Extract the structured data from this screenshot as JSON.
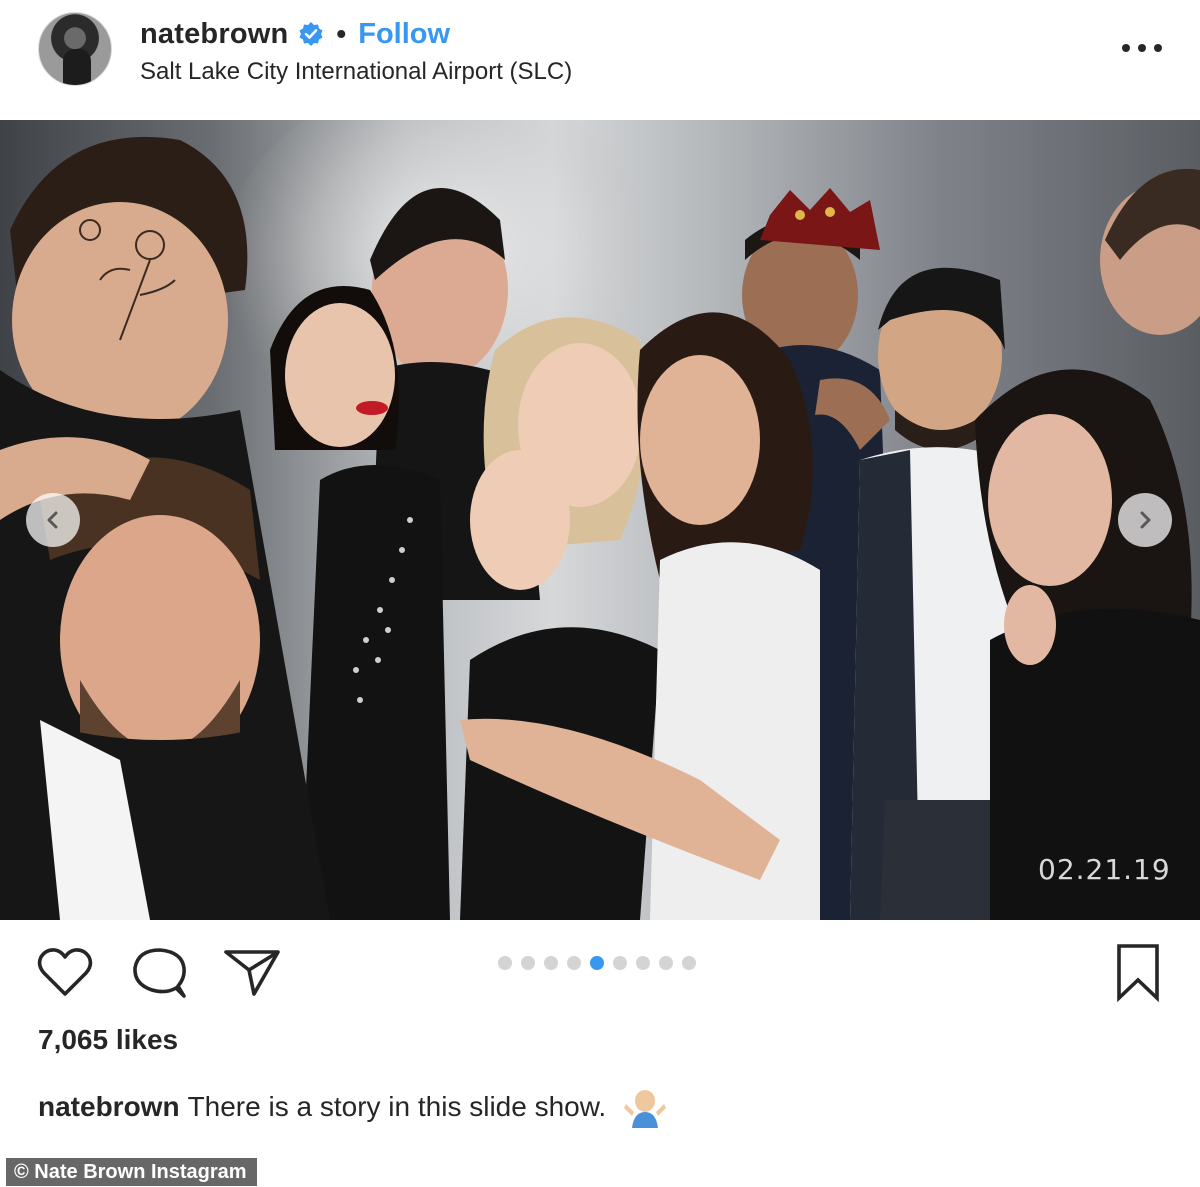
{
  "post": {
    "username": "natebrown",
    "follow_label": "Follow",
    "separator": "•",
    "location": "Salt Lake City International Airport (SLC)"
  },
  "photo": {
    "date_stamp": "02.21.19",
    "carousel_total": 9,
    "carousel_active_index": 4
  },
  "engagement": {
    "likes_label": "7,065 likes"
  },
  "caption": {
    "username": "natebrown",
    "text": "There is a story in this slide show."
  },
  "credit": "© Nate Brown Instagram",
  "icons": {
    "verified": "verified-badge-icon",
    "more": "more-options-icon",
    "like": "heart-icon",
    "comment": "comment-icon",
    "share": "paper-plane-icon",
    "save": "bookmark-icon",
    "prev": "chevron-left-icon",
    "next": "chevron-right-icon",
    "emoji": "person-shrugging-emoji"
  },
  "colors": {
    "link_blue": "#3897f0",
    "text": "#262626",
    "dot_inactive": "#d4d4d4"
  }
}
